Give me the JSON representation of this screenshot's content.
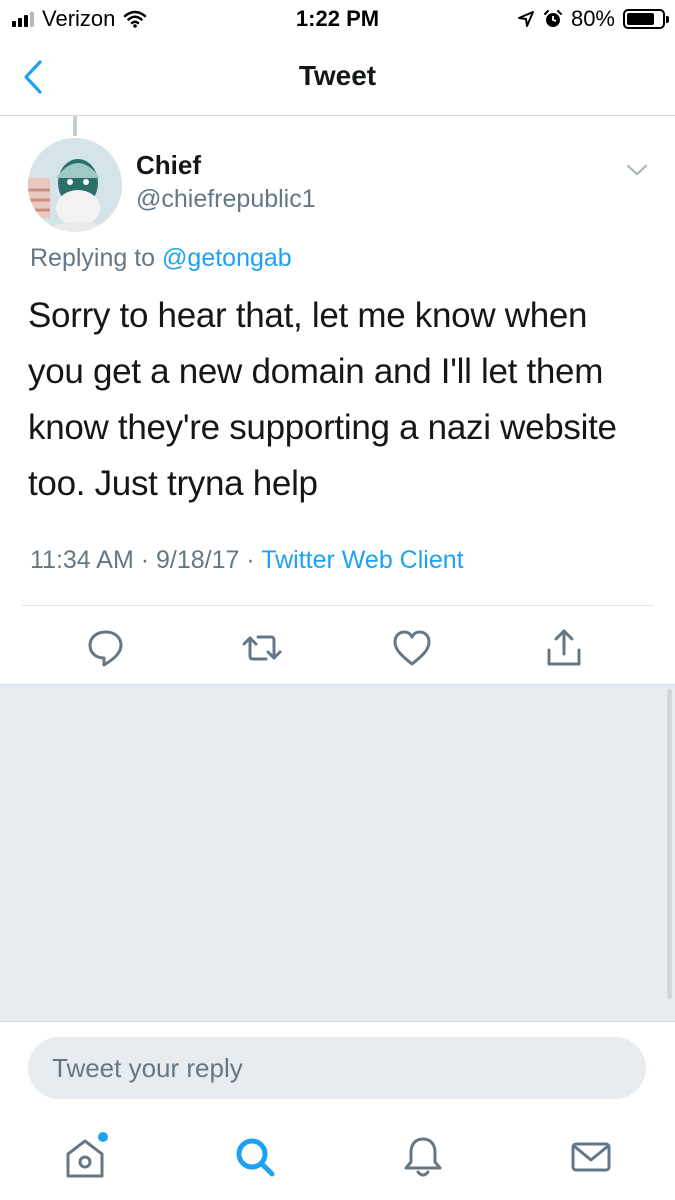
{
  "status_bar": {
    "carrier": "Verizon",
    "time": "1:22 PM",
    "battery_percent": "80%",
    "battery_level": 0.8,
    "icons": [
      "signal-icon",
      "wifi-icon",
      "location-icon",
      "alarm-icon",
      "battery-icon"
    ]
  },
  "nav": {
    "title": "Tweet",
    "back_icon": "chevron-left-icon"
  },
  "tweet": {
    "display_name": "Chief",
    "handle": "@chiefrepublic1",
    "replying_prefix": "Replying to",
    "replying_to": "@getongab",
    "text": "Sorry to hear that, let me know when you get a new domain and I'll let them know they're supporting a nazi website too. Just tryna help",
    "time": "11:34 AM",
    "date": "9/18/17",
    "separator": "·",
    "client": "Twitter Web Client"
  },
  "actions": [
    "reply-icon",
    "retweet-icon",
    "like-icon",
    "share-icon"
  ],
  "composer": {
    "placeholder": "Tweet your reply"
  },
  "tabs": [
    "home-icon",
    "search-icon",
    "notifications-icon",
    "messages-icon"
  ],
  "colors": {
    "accent": "#1da1f2",
    "secondary_text": "#657786",
    "primary_text": "#14171a",
    "background_gray": "#e6ecf0"
  }
}
